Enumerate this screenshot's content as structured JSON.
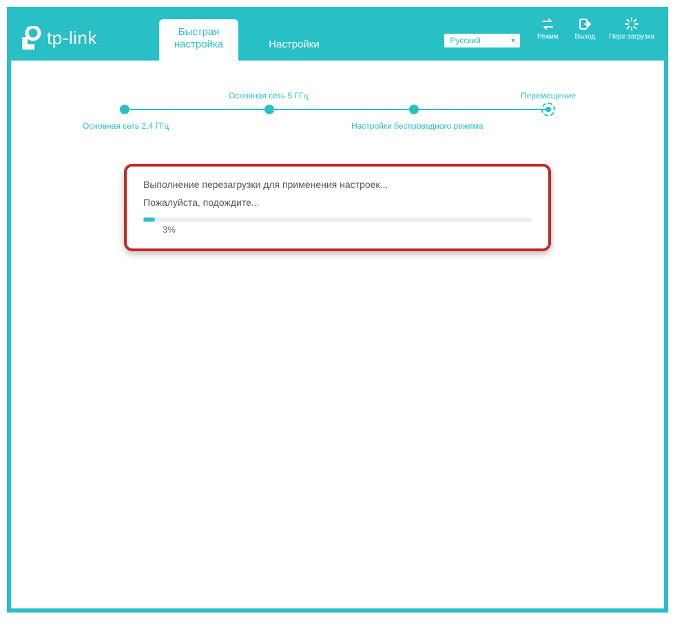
{
  "brand": {
    "name": "tp-link"
  },
  "tabs": {
    "quick_setup": "Быстрая\nнастройка",
    "settings": "Настройки"
  },
  "language": {
    "selected": "Русский"
  },
  "top_buttons": {
    "mode": "Режим",
    "logout": "Выход",
    "reboot": "Пере загрузка"
  },
  "stepper": {
    "step1": "Основная сеть 2,4 ГГц",
    "step2": "Основная сеть 5 ГГц",
    "step3": "Настройки беспроводного режима",
    "step4": "Перемещение"
  },
  "progress": {
    "line1": "Выполнение перезагрузки для применения настроек...",
    "line2": "Пожалуйста, подождите...",
    "percent_text": "3%",
    "percent_width": "3%"
  }
}
